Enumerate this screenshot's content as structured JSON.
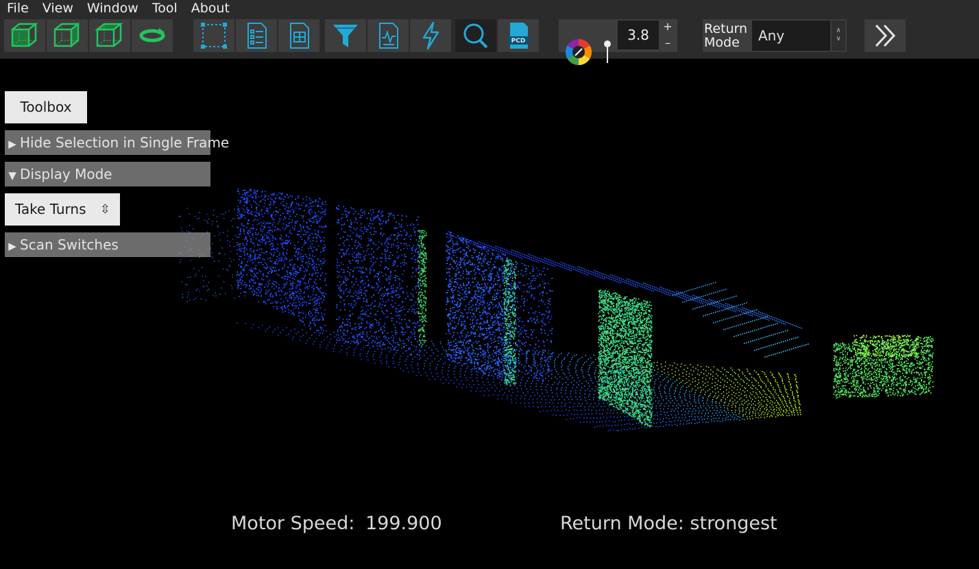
{
  "menubar": {
    "items": [
      {
        "label": "File"
      },
      {
        "label": "View"
      },
      {
        "label": "Window"
      },
      {
        "label": "Tool"
      },
      {
        "label": "About"
      }
    ]
  },
  "toolbar": {
    "buttons": [
      {
        "icon": "cube-front-view-icon"
      },
      {
        "icon": "cube-side-view-icon"
      },
      {
        "icon": "cube-top-view-icon"
      },
      {
        "icon": "rotate-view-icon"
      },
      {
        "icon": "selection-box-icon"
      },
      {
        "icon": "list-document-icon"
      },
      {
        "icon": "grid-document-icon"
      },
      {
        "icon": "filter-funnel-icon"
      },
      {
        "icon": "waveform-document-icon"
      },
      {
        "icon": "lightning-icon"
      },
      {
        "icon": "search-magnifier-icon"
      },
      {
        "icon": "pcd-file-icon",
        "text": "PCD"
      }
    ],
    "color_wheel_icon": "color-wheel-icon",
    "point_size_icon": "point-size-pin-icon",
    "point_size_value": "3.8",
    "plus": "+",
    "minus": "–",
    "return_mode_label_line1": "Return",
    "return_mode_label_line2": "Mode",
    "return_mode_value": "Any",
    "more_icon": "double-chevron-right-icon"
  },
  "left_panel": {
    "toolbox_label": "Toolbox",
    "hide_selection_label": "Hide Selection in Single Frame",
    "display_mode_label": "Display Mode",
    "display_mode_value": "Take Turns",
    "scan_switches_label": "Scan Switches"
  },
  "status": {
    "motor_speed_label": "Motor Speed:",
    "motor_speed_value": "199.900",
    "return_mode_status": "Return Mode: strongest"
  },
  "colors": {
    "toolbar_bg": "#2b2b2b",
    "button_bg": "#3d3d3d",
    "icon_green": "#22c55e",
    "icon_cyan": "#22a9d8"
  }
}
